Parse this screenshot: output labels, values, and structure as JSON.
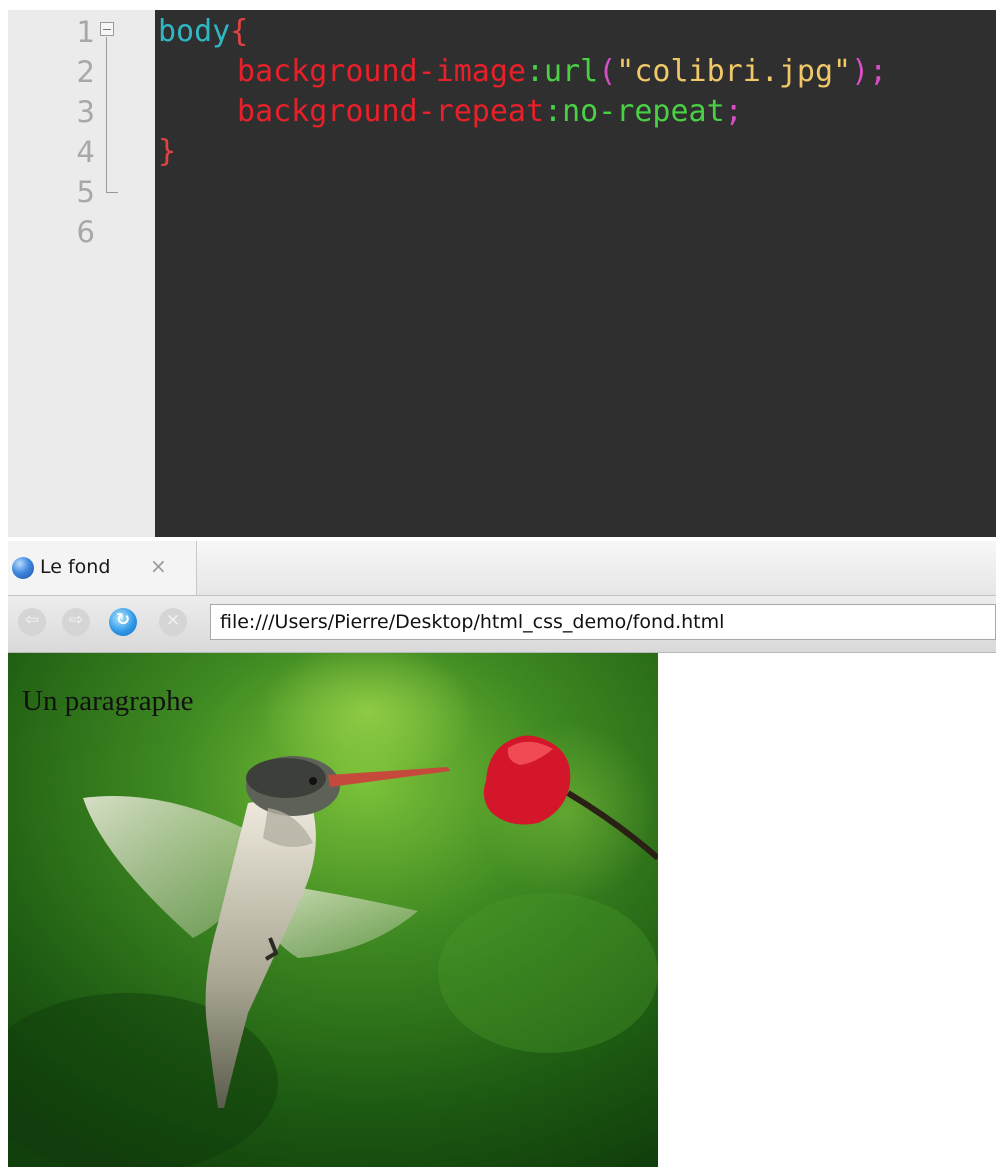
{
  "editor": {
    "line_numbers": [
      "1",
      "2",
      "3",
      "4",
      "5",
      "6"
    ],
    "code": {
      "l1_selector": "body",
      "l1_brace": "{",
      "l2_prop": "background-image",
      "l2_colon": ":",
      "l2_func": "url",
      "l2_open": "(",
      "l2_string": "\"colibri.jpg\"",
      "l2_close": ");",
      "l3_prop": "background-repeat",
      "l3_colon": ":",
      "l3_value": "no-repeat",
      "l3_semicolon": ";",
      "l4_brace": "}"
    },
    "colors": {
      "background": "#2f2f2f",
      "gutter": "#ebebeb",
      "selector": "#2fb8c4",
      "property": "#e8202a",
      "value": "#49d045",
      "string": "#f0c869",
      "punctuation": "#d64fc7"
    }
  },
  "browser": {
    "tab": {
      "title": "Le fond",
      "close_glyph": "×",
      "icon": "globe-icon"
    },
    "toolbar": {
      "back_glyph": "⇦",
      "forward_glyph": "⇨",
      "reload_glyph": "↻",
      "stop_glyph": "×",
      "url": "file:///Users/Pierre/Desktop/html_css_demo/fond.html"
    }
  },
  "page": {
    "paragraph": "Un paragraphe",
    "background_image": "hummingbird-flower-image"
  }
}
